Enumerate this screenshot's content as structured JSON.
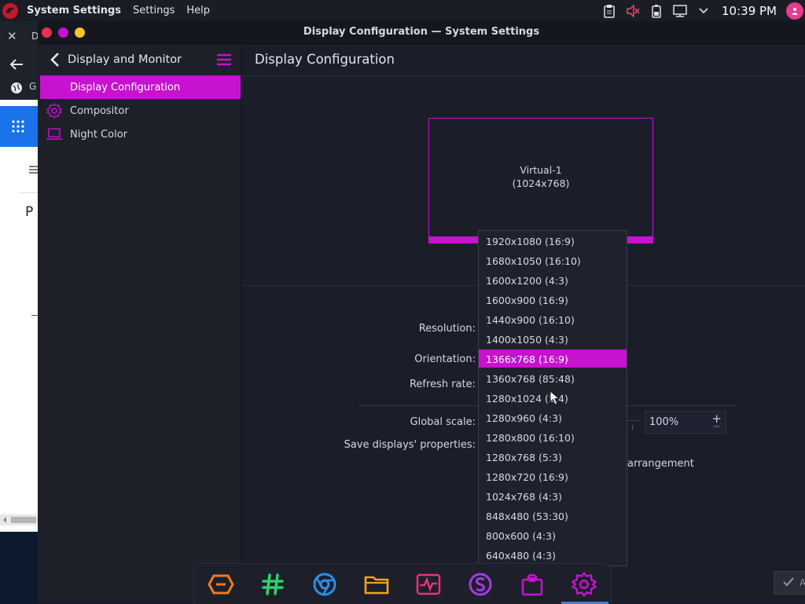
{
  "topbar": {
    "menu": [
      "System Settings",
      "Settings",
      "Help"
    ],
    "clock": "10:39 PM",
    "tray_icons": [
      "clipboard-icon",
      "volume-muted-icon",
      "battery-icon",
      "network-icon",
      "chevron-down-icon"
    ]
  },
  "background_window": {
    "close_glyph": "✕",
    "tab_char": "D",
    "addr_char": "G",
    "page_char": "P"
  },
  "window": {
    "title": "Display Configuration — System Settings",
    "controls": [
      "close",
      "minimize",
      "maximize"
    ]
  },
  "sidebar": {
    "header_title": "Display and Monitor",
    "items": [
      {
        "label": "Display Configuration",
        "icon": "display-icon",
        "active": true
      },
      {
        "label": "Compositor",
        "icon": "gear-icon",
        "active": false
      },
      {
        "label": "Night Color",
        "icon": "laptop-icon",
        "active": false
      }
    ]
  },
  "content": {
    "page_title": "Display Configuration",
    "monitor": {
      "name": "Virtual-1",
      "resolution": "(1024x768)"
    },
    "labels": {
      "resolution": "Resolution:",
      "orientation": "Orientation:",
      "refresh_rate": "Refresh rate:",
      "global_scale": "Global scale:",
      "save_props": "Save displays' properties:"
    },
    "global_scale_value": "100%",
    "arrangement_text": "arrangement",
    "apply_label": "A"
  },
  "dropdown": {
    "options": [
      "1920x1080 (16:9)",
      "1680x1050 (16:10)",
      "1600x1200 (4:3)",
      "1600x900 (16:9)",
      "1440x900 (16:10)",
      "1400x1050 (4:3)",
      "1366x768 (16:9)",
      "1360x768 (85:48)",
      "1280x1024 (5:4)",
      "1280x960 (4:3)",
      "1280x800 (16:10)",
      "1280x768 (5:3)",
      "1280x720 (16:9)",
      "1024x768 (4:3)",
      "848x480 (53:30)",
      "800x600 (4:3)",
      "640x480 (4:3)"
    ],
    "selected": "1366x768 (16:9)"
  },
  "dock": {
    "items": [
      "garuda-icon",
      "hashtag-icon",
      "chromium-icon",
      "folder-icon",
      "activity-icon",
      "s-app-icon",
      "store-bag-icon",
      "settings-gear-icon"
    ]
  },
  "colors": {
    "accent": "#c712cf",
    "background": "#1b1e28"
  }
}
